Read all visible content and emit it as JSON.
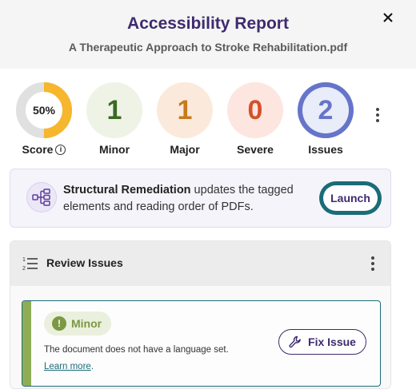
{
  "header": {
    "title": "Accessibility Report",
    "subtitle": "A Therapeutic Approach to Stroke Rehabilitation.pdf",
    "close_icon": "close-icon"
  },
  "metrics": {
    "score": {
      "value": "50%",
      "label": "Score",
      "fraction": 0.5,
      "ring_color": "#f6b62d",
      "track_color": "#e0e0e0"
    },
    "minor": {
      "value": "1",
      "label": "Minor",
      "bg": "#eef3e6",
      "color": "#3a6a23"
    },
    "major": {
      "value": "1",
      "label": "Major",
      "bg": "#fbeadb",
      "color": "#c57b1c"
    },
    "severe": {
      "value": "0",
      "label": "Severe",
      "bg": "#fde6e0",
      "color": "#d4512a"
    },
    "issues": {
      "value": "2",
      "label": "Issues",
      "bg": "#e9ecf9",
      "ring_color": "#6674c9",
      "color": "#6674c9"
    }
  },
  "remediation": {
    "title": "Structural Remediation",
    "description": " updates the tagged elements and reading order of PDFs.",
    "button_label": "Launch",
    "icon": "structure-tree-icon"
  },
  "review": {
    "title": "Review Issues",
    "icon": "numbered-list-icon",
    "issue": {
      "severity": "Minor",
      "severity_icon": "exclamation-icon",
      "description": "The document does not have a language set.",
      "link_text": "Learn more",
      "link_suffix": ".",
      "fix_label": "Fix Issue",
      "fix_icon": "wrench-icon"
    }
  },
  "colors": {
    "brand": "#3f2a6e",
    "accent_teal": "#1a6c78",
    "minor_green": "#8fac57"
  }
}
